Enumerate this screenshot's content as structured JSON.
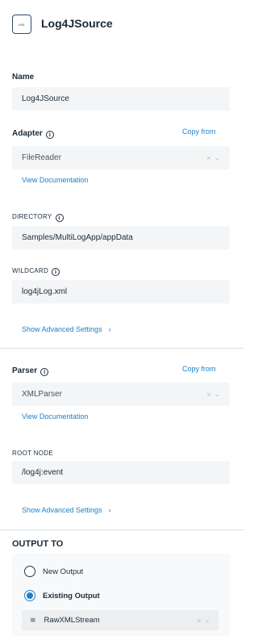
{
  "header": {
    "icon_text": "XML",
    "title": "Log4JSource"
  },
  "name": {
    "label": "Name",
    "value": "Log4JSource"
  },
  "adapter": {
    "label": "Adapter",
    "copy_from": "Copy from",
    "value": "FileReader",
    "view_docs": "View Documentation"
  },
  "directory": {
    "label": "DIRECTORY",
    "value": "Samples/MultiLogApp/appData"
  },
  "wildcard": {
    "label": "WILDCARD",
    "value": "log4jLog.xml"
  },
  "adapter_advanced": "Show Advanced Settings",
  "parser": {
    "label": "Parser",
    "copy_from": "Copy from",
    "value": "XMLParser",
    "view_docs": "View Documentation"
  },
  "root_node": {
    "label": "ROOT NODE",
    "value": "/log4j:event"
  },
  "parser_advanced": "Show Advanced Settings",
  "output": {
    "title": "OUTPUT TO",
    "options": [
      {
        "label": "New Output",
        "selected": false
      },
      {
        "label": "Existing Output",
        "selected": true
      }
    ],
    "stream": {
      "icon": "stream-icon",
      "value": "RawXMLStream"
    }
  },
  "icons": {
    "info": "i",
    "clear": "×",
    "chevron_down": "⌄",
    "chevron_right": "›",
    "stream": "≋"
  },
  "colors": {
    "accent": "#1f7fc6",
    "text": "#1c2b39",
    "field_bg": "#f4f5f6"
  }
}
